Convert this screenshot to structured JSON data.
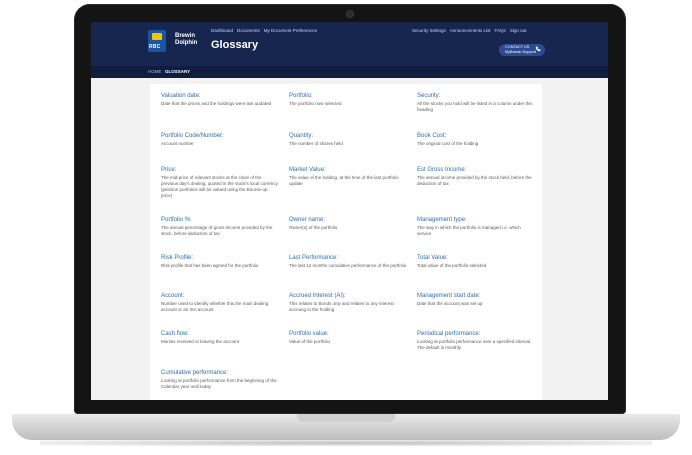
{
  "header": {
    "brand_line1": "Brewin",
    "brand_line2": "Dolphin",
    "logo_text": "RBC",
    "title": "Glossary",
    "nav_left": [
      "Dashboard",
      "Documents",
      "My Document Preferences"
    ],
    "nav_right": [
      "Security Settings",
      "Announcements List",
      "FAQs",
      "Sign out"
    ],
    "contact_line1": "CONTACT US",
    "contact_line2": "MyBrewin Support"
  },
  "breadcrumb": {
    "home": "HOME",
    "current": "GLOSSARY"
  },
  "glossary": [
    {
      "term": "Valuation date:",
      "definition": "Date that the prices and the holdings were last updated"
    },
    {
      "term": "Portfolio:",
      "definition": "The portfolio now selected"
    },
    {
      "term": "Security:",
      "definition": "All the stocks you hold will be listed in a column under this heading"
    },
    {
      "term": "Portfolio Code/Number:",
      "definition": "Account number"
    },
    {
      "term": "Quantity:",
      "definition": "The number of shares held"
    },
    {
      "term": "Book Cost:",
      "definition": "The original cost of the holding"
    },
    {
      "term": "Price:",
      "definition": "The mid-price of relevant stocks at the close of the previous day's dealing, quoted in the stock's local currency. (pension portfolios will be valued using the Bourse-up price)"
    },
    {
      "term": "Market Value:",
      "definition": "The value of the holding, at the time of the last portfolio update"
    },
    {
      "term": "Est Gross Income:",
      "definition": "The annual income provided by the stock held, before the deduction of tax"
    },
    {
      "term": "Portfolio %:",
      "definition": "The annual percentage of gross income provided by the stock, before deduction of tax"
    },
    {
      "term": "Owner name:",
      "definition": "Owner(s) of the portfolio"
    },
    {
      "term": "Management type:",
      "definition": "The way in which the portfolio is managed i.e. which service"
    },
    {
      "term": "Risk Profile:",
      "definition": "Risk profile that has been agreed for the portfolio"
    },
    {
      "term": "Last Performance:",
      "definition": "The last 12 months cumulative performance of the portfolio"
    },
    {
      "term": "Total Value:",
      "definition": "Total value of the portfolio selected"
    },
    {
      "term": "Account:",
      "definition": "Number used to identify whether this the main dealing account or an ISA account"
    },
    {
      "term": "Accrued Interest (AI):",
      "definition": "This relates to Bonds only and relates to any interest accruing to the holding"
    },
    {
      "term": "Management start date:",
      "definition": "Date that the account was set up"
    },
    {
      "term": "Cash flow:",
      "definition": "Monies received or leaving the account"
    },
    {
      "term": "Portfolio value:",
      "definition": "Value of the portfolio"
    },
    {
      "term": "Periodical performance:",
      "definition": "Looking at portfolio performance over a specified interval. The default is monthly"
    },
    {
      "term": "Cumulative performance:",
      "definition": "Looking at portfolio performance from the beginning of the Calendar year until today"
    }
  ],
  "colors": {
    "header_bg": "#16264f",
    "breadcrumb_bg": "#0f1d42",
    "term_color": "#2f6ea8",
    "rbc_blue": "#1a55a3",
    "rbc_yellow": "#f7c400"
  }
}
